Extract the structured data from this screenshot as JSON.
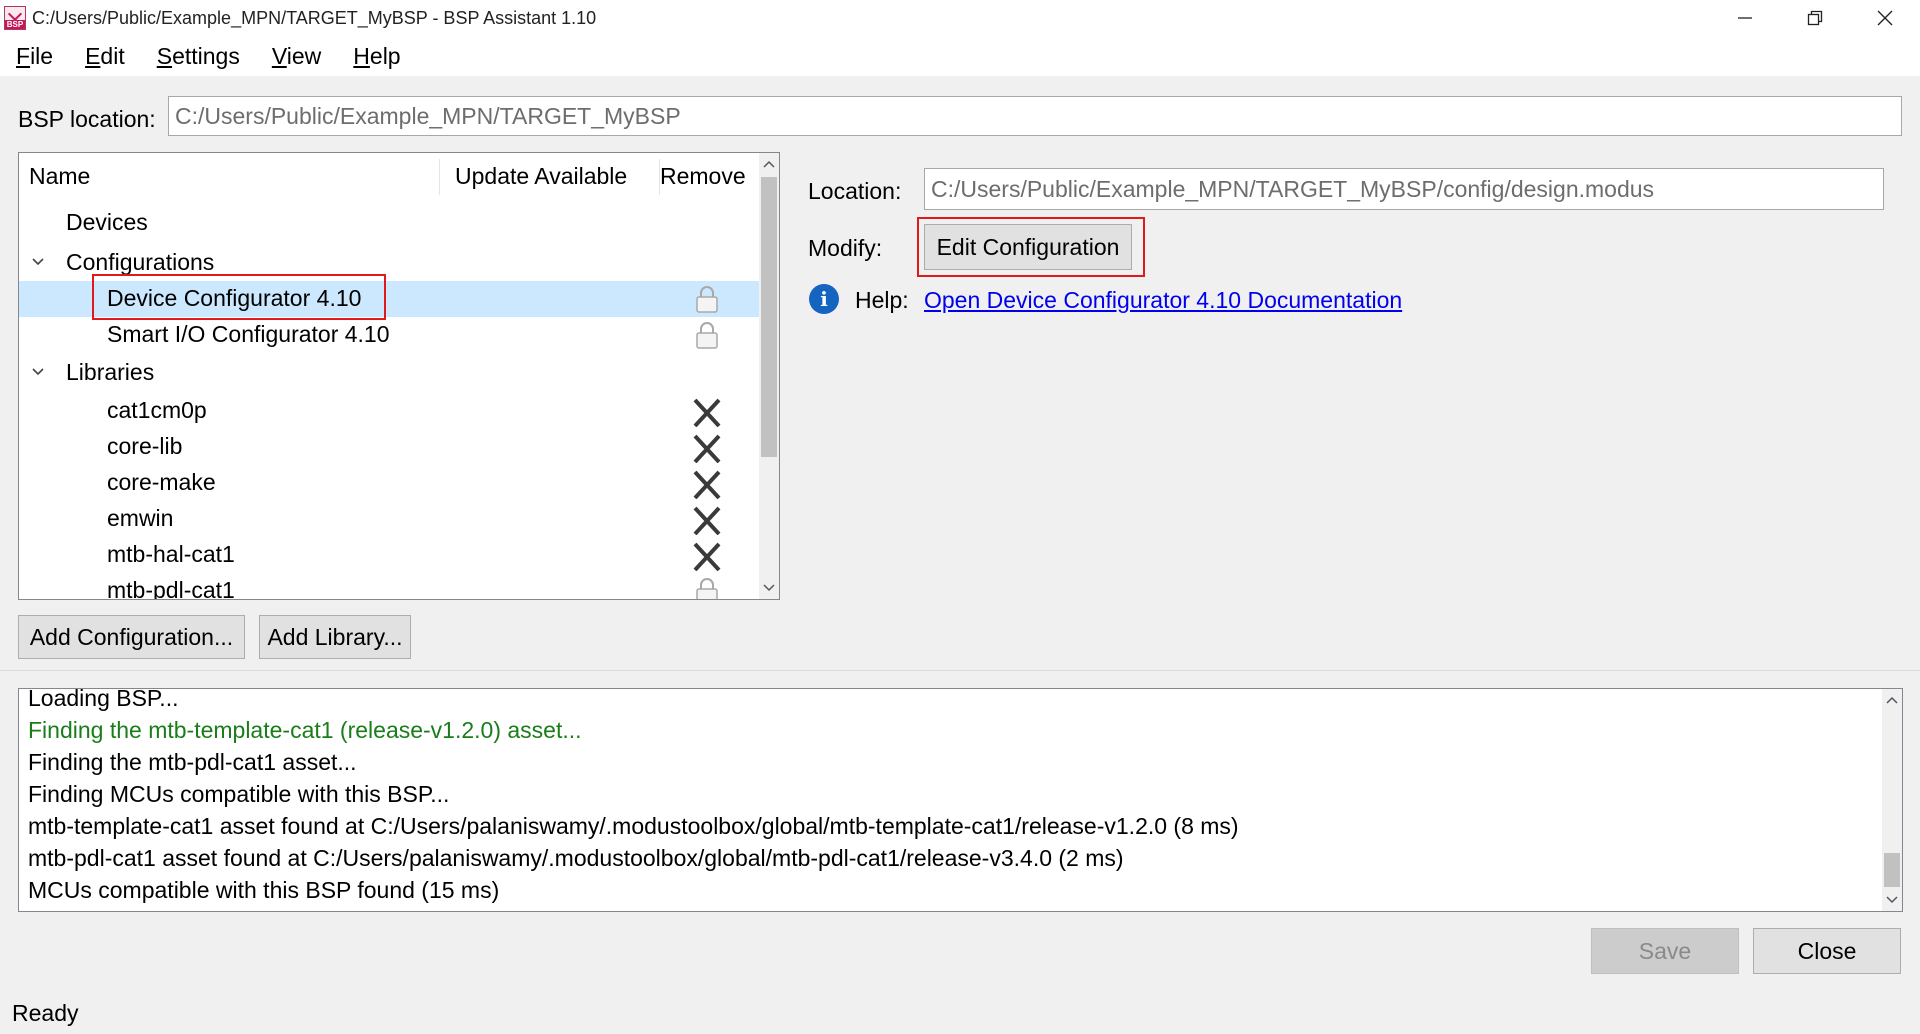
{
  "window": {
    "title": "C:/Users/Public/Example_MPN/TARGET_MyBSP - BSP Assistant 1.10",
    "icon_text": "BSP"
  },
  "menu": {
    "items": [
      {
        "accel": "F",
        "rest": "ile"
      },
      {
        "accel": "E",
        "rest": "dit"
      },
      {
        "accel": "S",
        "rest": "ettings"
      },
      {
        "accel": "V",
        "rest": "iew"
      },
      {
        "accel": "H",
        "rest": "elp"
      }
    ]
  },
  "bsp_location": {
    "label": "BSP location:",
    "value": "C:/Users/Public/Example_MPN/TARGET_MyBSP"
  },
  "tree": {
    "columns": [
      "Name",
      "Update Available",
      "Remove"
    ],
    "devices": "Devices",
    "configurations": {
      "label": "Configurations",
      "items": [
        "Device Configurator 4.10",
        "Smart I/O Configurator 4.10"
      ]
    },
    "libraries": {
      "label": "Libraries",
      "items": [
        "cat1cm0p",
        "core-lib",
        "core-make",
        "emwin",
        "mtb-hal-cat1",
        "mtb-pdl-cat1"
      ]
    },
    "selected": "Device Configurator 4.10"
  },
  "details": {
    "location_label": "Location:",
    "location_value": "C:/Users/Public/Example_MPN/TARGET_MyBSP/config/design.modus",
    "modify_label": "Modify:",
    "edit_button": "Edit Configuration",
    "help_label": "Help:",
    "help_link": "Open Device Configurator 4.10 Documentation"
  },
  "buttons": {
    "add_configuration": "Add Configuration...",
    "add_library": "Add Library...",
    "save": "Save",
    "close": "Close"
  },
  "log": {
    "lines": [
      "Loading BSP...",
      "Finding the mtb-template-cat1 (release-v1.2.0) asset...",
      "Finding the mtb-pdl-cat1 asset...",
      "Finding MCUs compatible with this BSP...",
      "mtb-template-cat1 asset found at C:/Users/palaniswamy/.modustoolbox/global/mtb-template-cat1/release-v1.2.0 (8 ms)",
      "mtb-pdl-cat1 asset found at C:/Users/palaniswamy/.modustoolbox/global/mtb-pdl-cat1/release-v3.4.0 (2 ms)",
      "MCUs compatible with this BSP found (15 ms)"
    ],
    "highlight_color": "#1a7d1a"
  },
  "status": "Ready",
  "colors": {
    "selection": "#cce8ff",
    "highlight_box": "#e01a1a",
    "link": "#0000ee",
    "info_icon": "#1565c0"
  },
  "icons": {
    "lock": "lock-icon",
    "remove": "x-remove-icon",
    "info": "info-icon"
  }
}
